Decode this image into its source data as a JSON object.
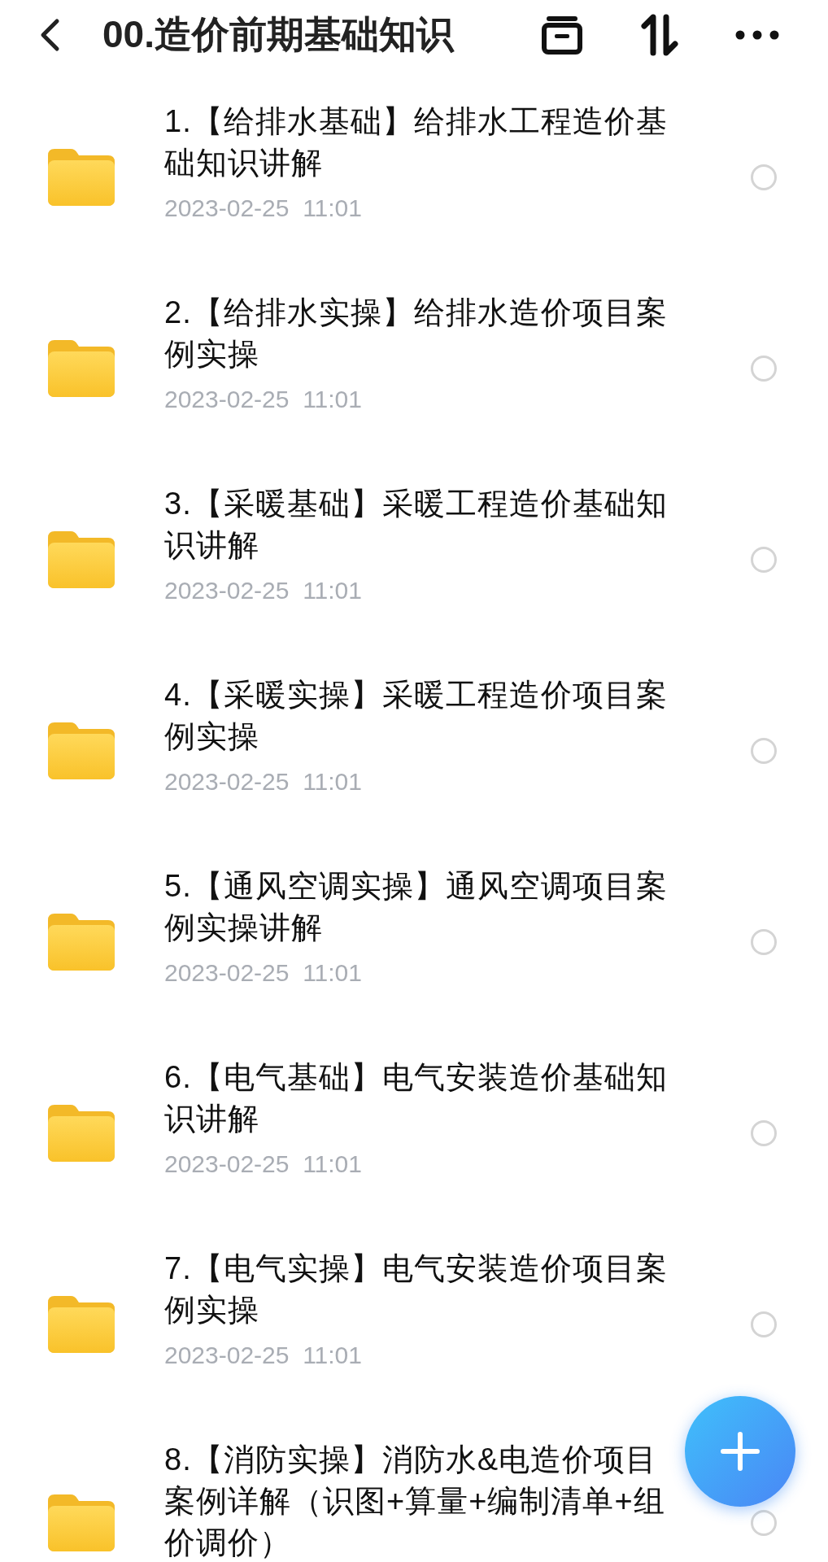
{
  "header": {
    "title": "00.造价前期基础知识"
  },
  "folders": [
    {
      "name": "1.【给排水基础】给排水工程造价基础知识讲解",
      "date": "2023-02-25  11:01",
      "selected": false
    },
    {
      "name": "2.【给排水实操】给排水造价项目案例实操",
      "date": "2023-02-25  11:01",
      "selected": false
    },
    {
      "name": "3.【采暖基础】采暖工程造价基础知识讲解",
      "date": "2023-02-25  11:01",
      "selected": false
    },
    {
      "name": "4.【采暖实操】采暖工程造价项目案例实操",
      "date": "2023-02-25  11:01",
      "selected": false
    },
    {
      "name": "5.【通风空调实操】通风空调项目案例实操讲解",
      "date": "2023-02-25  11:01",
      "selected": false
    },
    {
      "name": "6.【电气基础】电气安装造价基础知识讲解",
      "date": "2023-02-25  11:01",
      "selected": false
    },
    {
      "name": "7.【电气实操】电气安装造价项目案例实操",
      "date": "2023-02-25  11:01",
      "selected": false
    },
    {
      "name": "8.【消防实操】消防水&电造价项目案例详解（识图+算量+编制清单+组价调价）",
      "selected": false
    }
  ]
}
